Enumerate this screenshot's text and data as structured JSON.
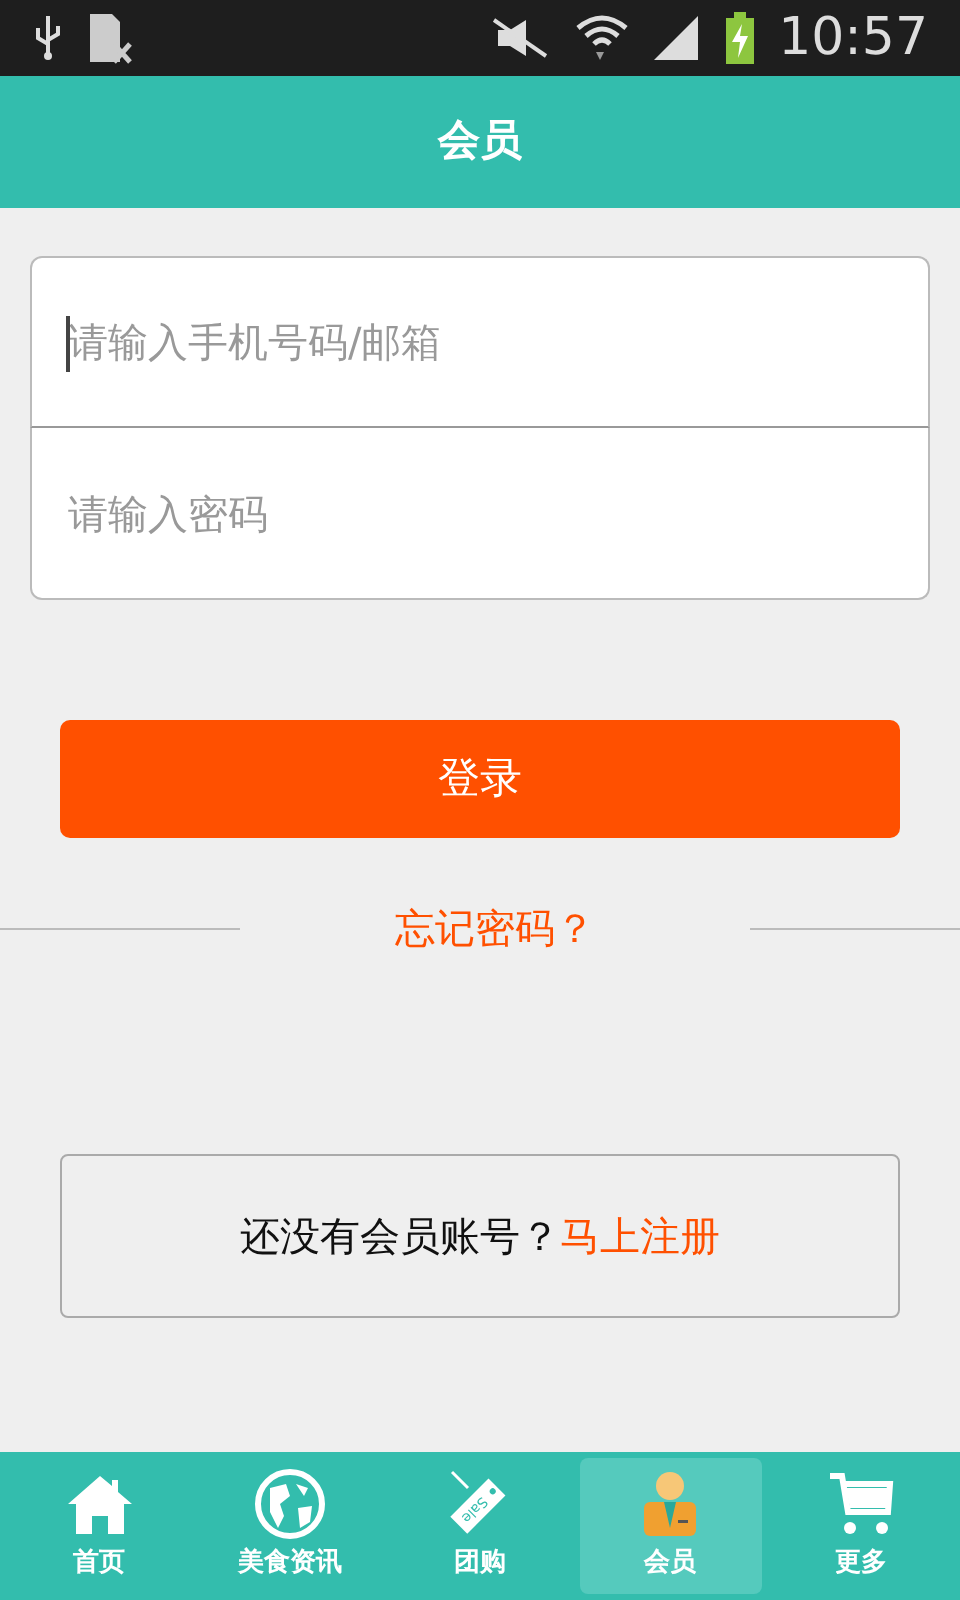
{
  "status_bar": {
    "time": "10:57",
    "battery_charging": true
  },
  "header": {
    "title": "会员"
  },
  "form": {
    "fields": [
      {
        "placeholder": "请输入手机号码/邮箱",
        "focused": true
      },
      {
        "placeholder": "请输入密码",
        "focused": false
      }
    ]
  },
  "login_button": "登录",
  "forgot_password": "忘记密码？",
  "register": {
    "prompt": "还没有会员账号？",
    "link": "马上注册"
  },
  "bottom_nav": [
    {
      "label": "首页",
      "kind": "home",
      "selected": false
    },
    {
      "label": "美食资讯",
      "kind": "globe",
      "selected": false
    },
    {
      "label": "团购",
      "kind": "tag",
      "icon_text": "Sale",
      "selected": false
    },
    {
      "label": "会员",
      "kind": "member",
      "selected": true
    },
    {
      "label": "更多",
      "kind": "cart",
      "selected": false
    }
  ]
}
